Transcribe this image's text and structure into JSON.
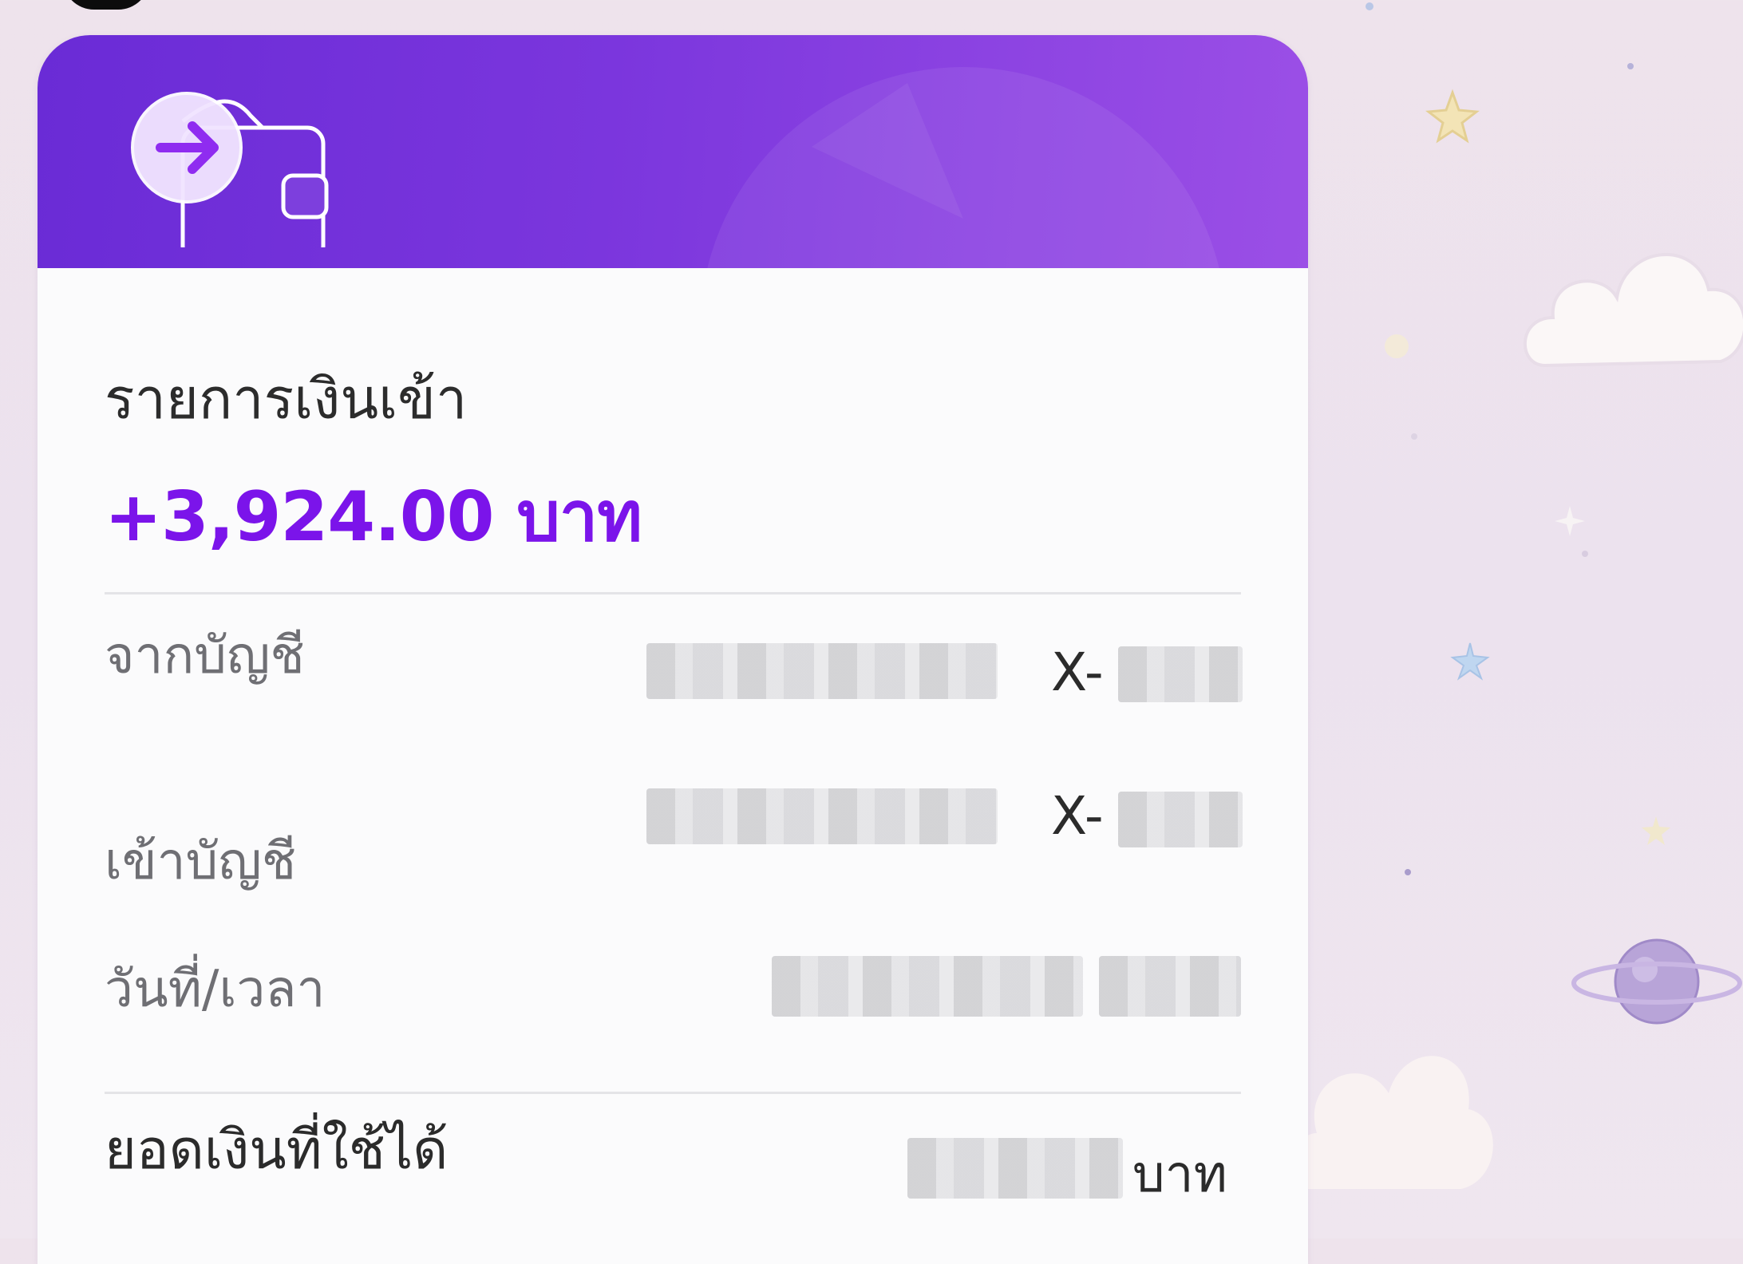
{
  "card": {
    "title": "รายการเงินเข้า",
    "amount": "+3,924.00 บาท",
    "accent_color": "#7b14ea",
    "header_gradient": [
      "#6a2bd6",
      "#9b4fe6"
    ],
    "header_icon": "wallet-arrow-in-icon"
  },
  "details": {
    "from_account_label": "จากบัญชี",
    "from_account_prefix": "X-",
    "to_account_label": "เข้าบัญชี",
    "to_account_prefix": "X-",
    "datetime_label": "วันที่/เวลา",
    "available_balance_label": "ยอดเงินที่ใช้ได้",
    "available_balance_unit": "บาท"
  },
  "background": {
    "decorations": [
      "star-icon",
      "cloud-icon",
      "planet-icon",
      "sparkle-icon"
    ]
  }
}
